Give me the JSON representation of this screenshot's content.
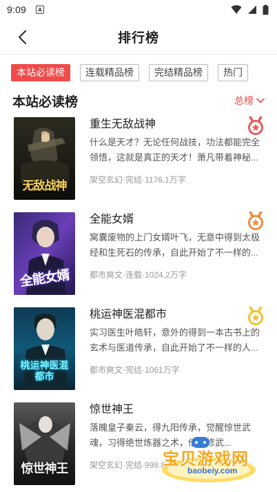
{
  "status_bar": {
    "time": "9:09",
    "notif_label": "A"
  },
  "header": {
    "title": "排行榜"
  },
  "tabs": [
    {
      "label": "本站必读榜",
      "active": true
    },
    {
      "label": "连载精品榜",
      "active": false
    },
    {
      "label": "完结精品榜",
      "active": false
    },
    {
      "label": "热门",
      "active": false
    }
  ],
  "section": {
    "title": "本站必读榜",
    "sort_label": "总榜"
  },
  "books": [
    {
      "title": "重生无敌战神",
      "desc": "什么是天才？无论任何战技，功法都能完全领悟，这就是真正的天才！萧凡带着神秘...",
      "meta": "架空玄幻·完结·1176.1万字",
      "cover_text": "无敌战神",
      "rank_color": "#e85a5a",
      "accent": "#f2c94c"
    },
    {
      "title": "全能女婿",
      "desc": "窝囊废物的上门女婿叶飞，无意中得到太极经和生死石的传承，自此开始了不一样的...",
      "meta": "都市爽文·连载·1024.2万字",
      "cover_text": "全能女婿",
      "rank_color": "#f08a3a",
      "accent": "#a27bff"
    },
    {
      "title": "桃运神医混都市",
      "desc": "实习医生叶皓轩，意外的得到一本古书上的玄术与医道传承，自此开始了不一样的人...",
      "meta": "都市爽文·完结·1061万字",
      "cover_text": "桃运神医混都市",
      "rank_color": "#f2c230",
      "accent": "#2fd1e8"
    },
    {
      "title": "惊世神王",
      "desc": "落魄皇子秦云，得九阳传承，觉醒惊世武魂，习得绝世炼器之术，他在修武...",
      "meta": "架空玄幻·完结·998.8万字",
      "cover_text": "惊世神王",
      "rank_color": "",
      "accent": "#d9d9d9"
    }
  ],
  "watermark": {
    "text": "宝贝游戏网",
    "url": "baobeiy.com"
  }
}
